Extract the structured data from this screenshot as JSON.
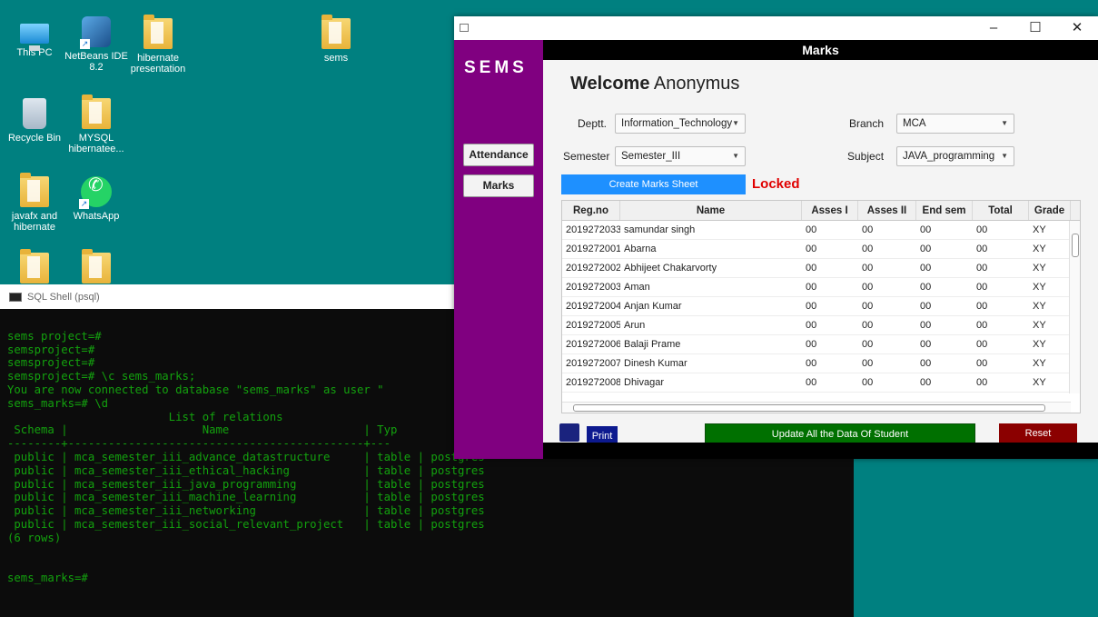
{
  "desktop": {
    "icons": [
      {
        "label": "This PC"
      },
      {
        "label": "NetBeans IDE 8.2"
      },
      {
        "label": "hibernate presentation"
      },
      {
        "label": "sems"
      },
      {
        "label": "Recycle Bin"
      },
      {
        "label": "MYSQL hibernatee..."
      },
      {
        "label": "javafx and hibernate"
      },
      {
        "label": "WhatsApp"
      }
    ]
  },
  "sql_shell": {
    "title": "SQL Shell (psql)",
    "lines": [
      "",
      "sems project=#",
      "semsproject=#",
      "semsproject=#",
      "semsproject=# \\c sems_marks;",
      "You are now connected to database \"sems_marks\" as user \"",
      "sems_marks=# \\d",
      "                        List of relations",
      " Schema |                    Name                    | Typ",
      "--------+--------------------------------------------+---",
      " public | mca_semester_iii_advance_datastructure     | table | postgres",
      " public | mca_semester_iii_ethical_hacking           | table | postgres",
      " public | mca_semester_iii_java_programming          | table | postgres",
      " public | mca_semester_iii_machine_learning          | table | postgres",
      " public | mca_semester_iii_networking                | table | postgres",
      " public | mca_semester_iii_social_relevant_project   | table | postgres",
      "(6 rows)",
      "",
      "",
      "sems_marks=#"
    ]
  },
  "sems_window": {
    "window_controls": {
      "minimize": "–",
      "maximize": "☐",
      "close": "✕"
    },
    "logo": "SEMS",
    "sidebar": {
      "attendance": "Attendance",
      "marks": "Marks"
    },
    "header": "Marks",
    "welcome_bold": "Welcome",
    "welcome_name": "Anonymus",
    "form": {
      "deptt_label": "Deptt.",
      "deptt_value": "Information_Technology",
      "branch_label": "Branch",
      "branch_value": "MCA",
      "semester_label": "Semester",
      "semester_value": "Semester_III",
      "subject_label": "Subject",
      "subject_value": "JAVA_programming"
    },
    "create_button": "Create Marks Sheet",
    "locked_text": "Locked",
    "table": {
      "headers": [
        "Reg.no",
        "Name",
        "Asses I",
        "Asses II",
        "End sem",
        "Total",
        "Grade"
      ],
      "rows": [
        [
          "2019272033",
          "samundar singh",
          "00",
          "00",
          "00",
          "00",
          "XY"
        ],
        [
          "2019272001",
          "Abarna",
          "00",
          "00",
          "00",
          "00",
          "XY"
        ],
        [
          "2019272002",
          "Abhijeet Chakarvorty",
          "00",
          "00",
          "00",
          "00",
          "XY"
        ],
        [
          "2019272003",
          "Aman",
          "00",
          "00",
          "00",
          "00",
          "XY"
        ],
        [
          "2019272004",
          "Anjan Kumar",
          "00",
          "00",
          "00",
          "00",
          "XY"
        ],
        [
          "2019272005",
          "Arun",
          "00",
          "00",
          "00",
          "00",
          "XY"
        ],
        [
          "2019272006",
          "Balaji Prame",
          "00",
          "00",
          "00",
          "00",
          "XY"
        ],
        [
          "2019272007",
          "Dinesh Kumar",
          "00",
          "00",
          "00",
          "00",
          "XY"
        ],
        [
          "2019272008",
          "Dhivagar",
          "00",
          "00",
          "00",
          "00",
          "XY"
        ]
      ]
    },
    "print_button": "Print",
    "update_button": "Update All the Data Of Student",
    "reset_button": "Reset"
  }
}
